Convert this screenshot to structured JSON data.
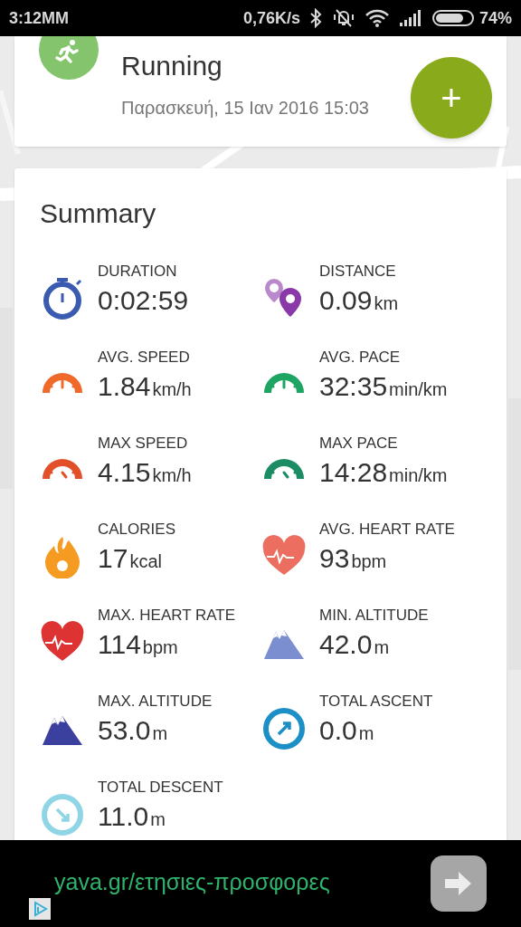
{
  "status_bar": {
    "time": "3:12MM",
    "speed": "0,76K/s",
    "battery": "74%"
  },
  "activity": {
    "title": "Running",
    "date": "Παρασκευή, 15 Ιαν 2016 15:03",
    "add_button": "+"
  },
  "summary": {
    "title": "Summary",
    "metrics": [
      {
        "kind": "stopwatch",
        "color": "#3b5bb0",
        "label": "DURATION",
        "value": "0:02:59"
      },
      {
        "kind": "pins",
        "color": "#8a3aa8",
        "label": "DISTANCE",
        "value": "0.09",
        "unit": "km"
      },
      {
        "kind": "gauge",
        "color": "#ef6a2a",
        "label": "AVG. SPEED",
        "value": "1.84",
        "unit": "km/h"
      },
      {
        "kind": "gauge",
        "color": "#1ea463",
        "label": "AVG. PACE",
        "value": "32:35",
        "unit": "min/km"
      },
      {
        "kind": "gauge",
        "color": "#e2502a",
        "label": "MAX SPEED",
        "value": "4.15",
        "unit": "km/h"
      },
      {
        "kind": "gauge",
        "color": "#1b8c64",
        "label": "MAX PACE",
        "value": "14:28",
        "unit": "min/km"
      },
      {
        "kind": "flame",
        "color": "#f59b21",
        "label": "CALORIES",
        "value": "17",
        "unit": "kcal"
      },
      {
        "kind": "heart",
        "color": "#ec6e60",
        "label": "AVG. HEART RATE",
        "value": "93",
        "unit": "bpm"
      },
      {
        "kind": "heart",
        "color": "#dd3433",
        "label": "MAX. HEART RATE",
        "value": "114",
        "unit": "bpm"
      },
      {
        "kind": "mountains",
        "color": "#7b8fd0",
        "label": "MIN. ALTITUDE",
        "value": "42.0",
        "unit": "m"
      },
      {
        "kind": "mountains",
        "color": "#3b3f9e",
        "label": "MAX. ALTITUDE",
        "value": "53.0",
        "unit": "m"
      },
      {
        "kind": "ascent",
        "color": "#1b8fc6",
        "label": "TOTAL ASCENT",
        "value": "0.0",
        "unit": "m"
      },
      {
        "kind": "descent",
        "color": "#8fd5e6",
        "label": "TOTAL DESCENT",
        "value": "11.0",
        "unit": "m"
      }
    ]
  },
  "ad": {
    "text": "yava.gr/ετησιες-προσφορες"
  }
}
